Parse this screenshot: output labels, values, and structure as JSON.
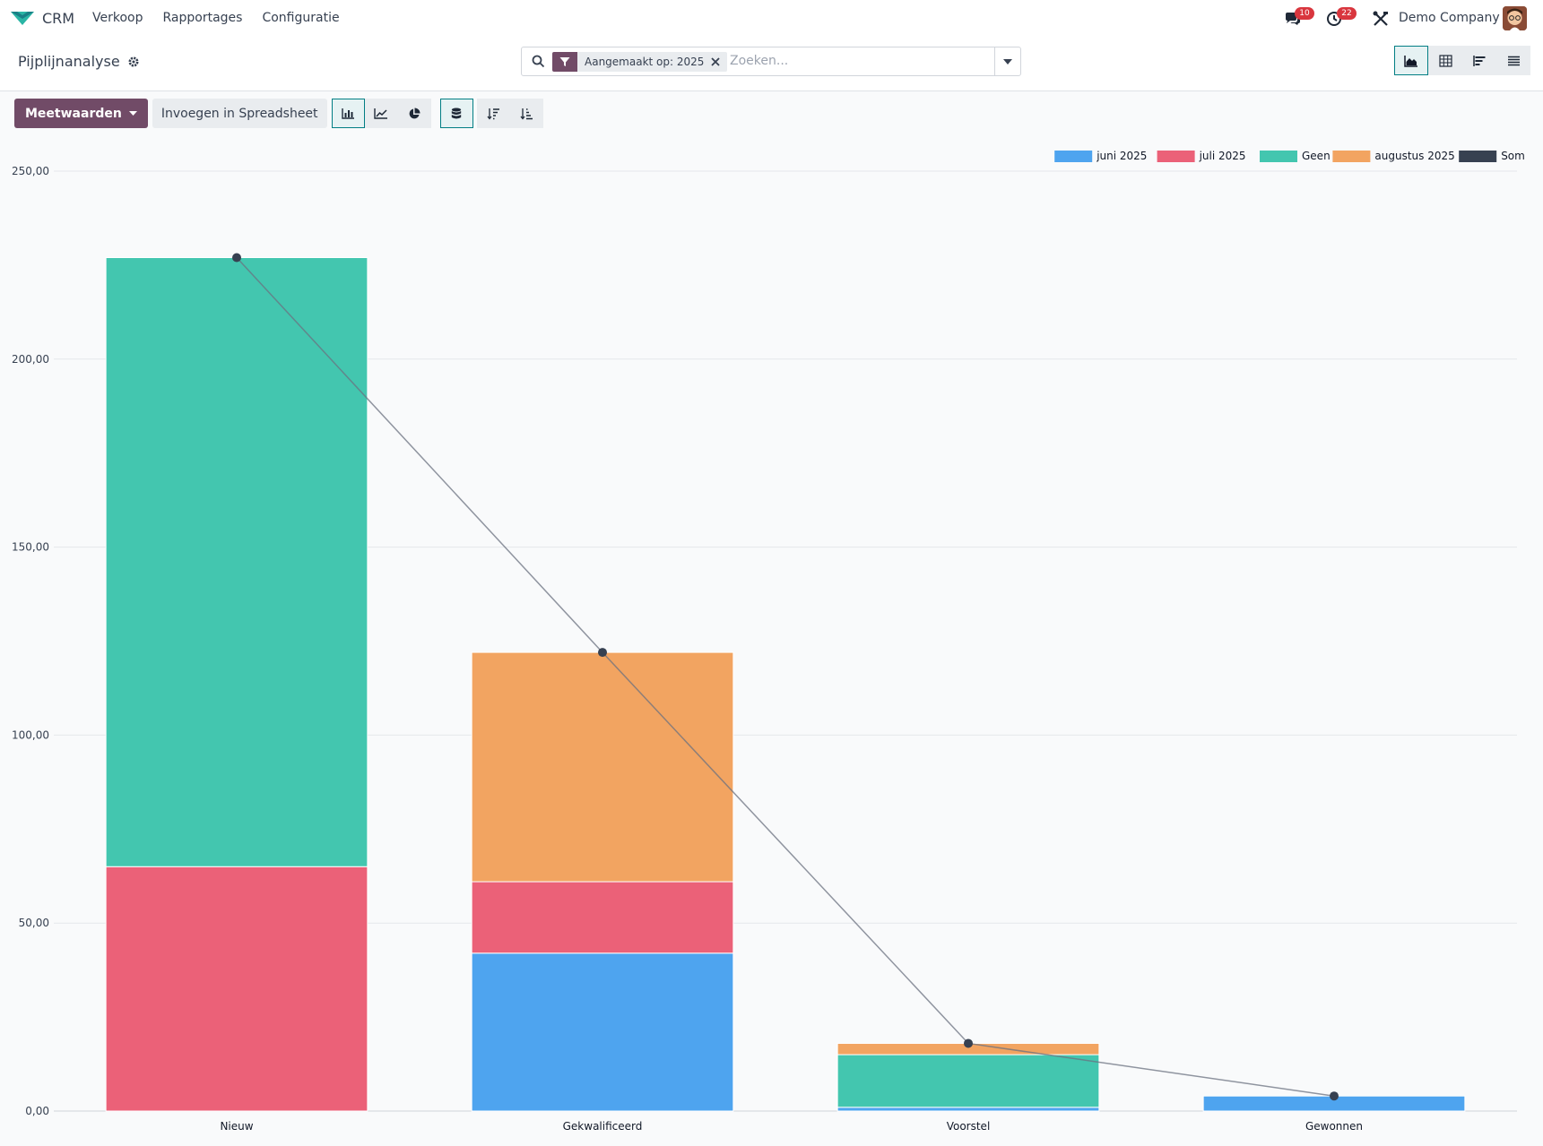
{
  "navbar": {
    "app_name": "CRM",
    "menu": [
      "Verkoop",
      "Rapportages",
      "Configuratie"
    ],
    "messages_count": "10",
    "activities_count": "22",
    "company": "Demo Company"
  },
  "control_panel": {
    "title": "Pijplijnanalyse",
    "facet_label": "Aangemaakt op: 2025",
    "search_placeholder": "Zoeken..."
  },
  "toolbar": {
    "measures_label": "Meetwaarden",
    "insert_label": "Invoegen in Spreadsheet"
  },
  "colors": {
    "accent": "#714b67",
    "teal": "#017e84",
    "juni": "#4ea4ef",
    "juli": "#eb6178",
    "geen": "#43c6af",
    "augustus": "#f2a461",
    "som": "#374151"
  },
  "chart_data": {
    "type": "bar",
    "stacked": true,
    "categories": [
      "Nieuw",
      "Gekwalificeerd",
      "Voorstel",
      "Gewonnen"
    ],
    "series": [
      {
        "name": "juni 2025",
        "color": "#4ea4ef",
        "values": [
          0,
          42,
          1,
          4
        ]
      },
      {
        "name": "juli 2025",
        "color": "#eb6178",
        "values": [
          65,
          19,
          0,
          0
        ]
      },
      {
        "name": "Geen",
        "color": "#43c6af",
        "values": [
          162,
          0,
          14,
          0
        ]
      },
      {
        "name": "augustus 2025",
        "color": "#f2a461",
        "values": [
          0,
          61,
          3,
          0
        ]
      },
      {
        "name": "Som",
        "color": "#374151",
        "type": "line",
        "values": [
          227,
          122,
          18,
          4
        ]
      }
    ],
    "ylim": [
      0,
      250
    ],
    "yticks": [
      "0,00",
      "50,00",
      "100,00",
      "150,00",
      "200,00",
      "250,00"
    ],
    "legend_position": "top-right",
    "grid": true
  }
}
